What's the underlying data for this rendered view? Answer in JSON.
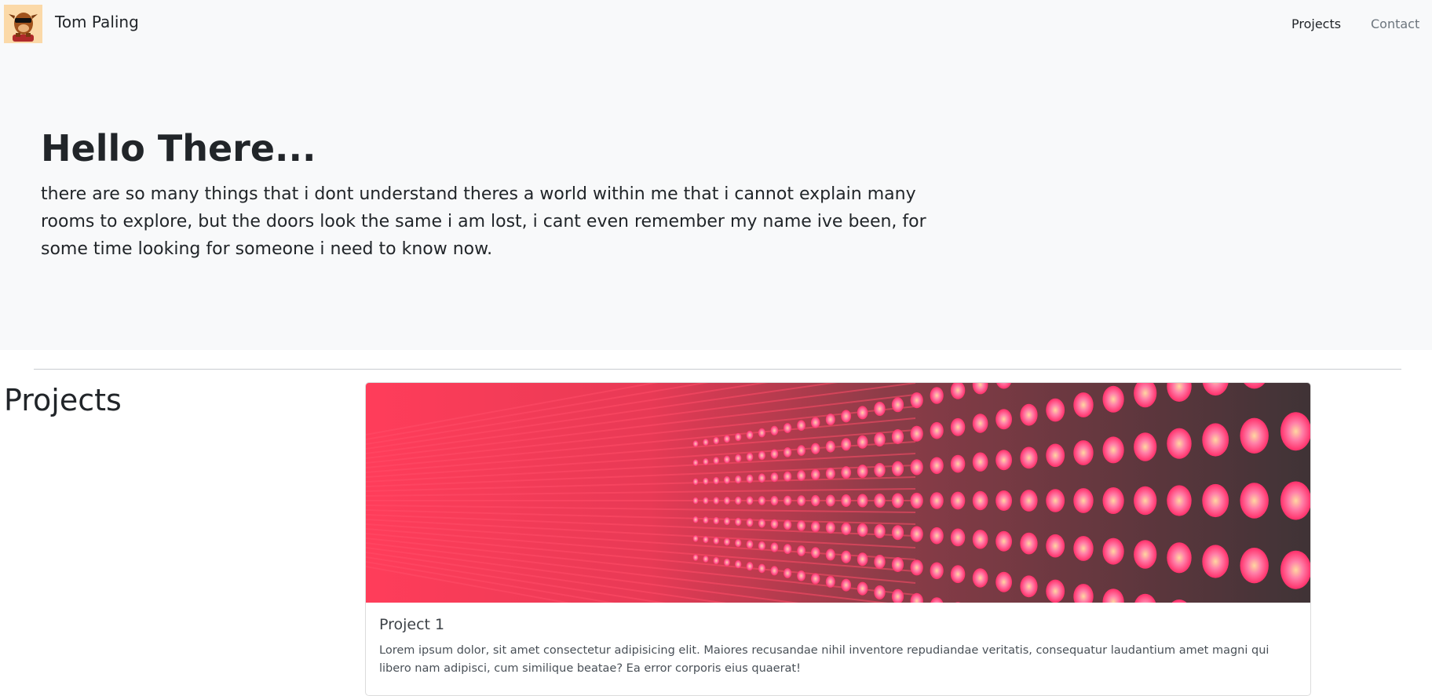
{
  "navbar": {
    "brand_name": "Tom Paling",
    "links": [
      {
        "label": "Projects",
        "active": true
      },
      {
        "label": "Contact",
        "active": false
      }
    ]
  },
  "hero": {
    "title": "Hello There...",
    "text": "there are so many things that i dont understand theres a world within me that i cannot explain many rooms to explore, but the doors look the same i am lost, i cant even remember my name ive been, for some time looking for someone i need to know now."
  },
  "projects": {
    "heading": "Projects",
    "cards": [
      {
        "title": "Project 1",
        "text": "Lorem ipsum dolor, sit amet consectetur adipisicing elit. Maiores recusandae nihil inventore repudiandae veritatis, consequatur laudantium amet magni qui libero nam adipisci, cum similique beatae? Ea error corporis eius quaerat!"
      }
    ]
  },
  "colors": {
    "navbar_bg": "#f8f9fa",
    "hero_bg": "#f8f9fa",
    "text_primary": "#212529",
    "text_muted": "#6c757d",
    "led_glow": "#ff3d5a",
    "led_backdrop": "#4a3a3d"
  },
  "icons": {
    "brand_logo": "avatar-cartoon-icon"
  }
}
